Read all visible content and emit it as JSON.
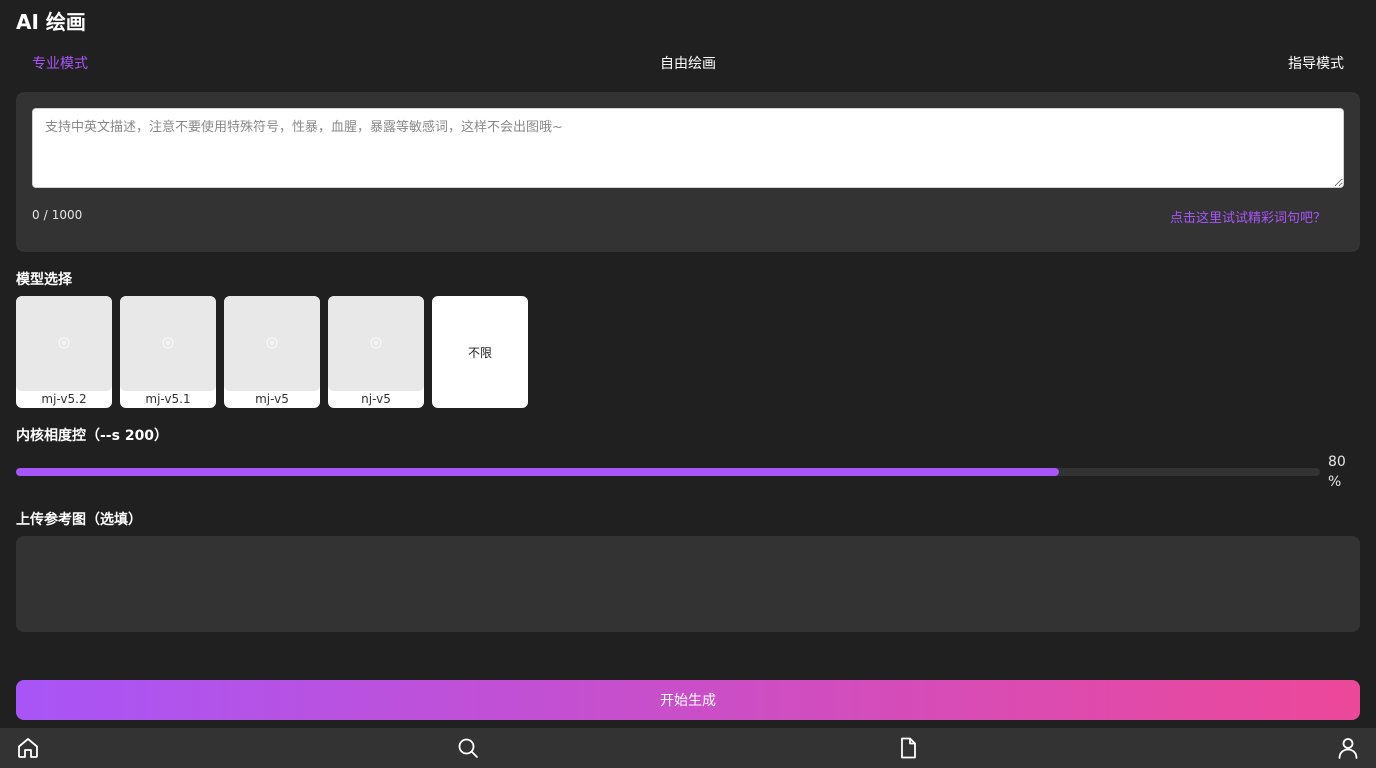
{
  "header": {
    "title": "AI 绘画"
  },
  "tabs": [
    {
      "label": "专业模式",
      "active": true
    },
    {
      "label": "自由绘画",
      "active": false
    },
    {
      "label": "指导模式",
      "active": false
    }
  ],
  "prompt": {
    "placeholder": "支持中英文描述，注意不要使用特殊符号，性暴，血腥，暴露等敏感词，这样不会出图哦~",
    "value": "",
    "char_count": "0",
    "char_limit": "1000",
    "separator": "/",
    "inspire_link": "点击这里试试精彩词句吧？"
  },
  "models": {
    "label": "模型选择",
    "items": [
      {
        "name": "mj-v5.2"
      },
      {
        "name": "mj-v5.1"
      },
      {
        "name": "mj-v5"
      },
      {
        "name": "nj-v5"
      }
    ],
    "unlimited_label": "不限"
  },
  "stylize": {
    "label": "内核相度控（--s 200）",
    "value": 80,
    "value_text": "80",
    "unit": "%"
  },
  "upload": {
    "label": "上传参考图（选填）"
  },
  "actions": {
    "generate_label": "开始生成"
  },
  "bottom_nav": {
    "items": [
      {
        "icon": "home-icon"
      },
      {
        "icon": "search-icon"
      },
      {
        "icon": "document-icon"
      },
      {
        "icon": "user-icon"
      }
    ]
  },
  "colors": {
    "accent": "#a855f7",
    "gradient_end": "#ec4899",
    "background": "#202020",
    "panel": "#333333"
  }
}
